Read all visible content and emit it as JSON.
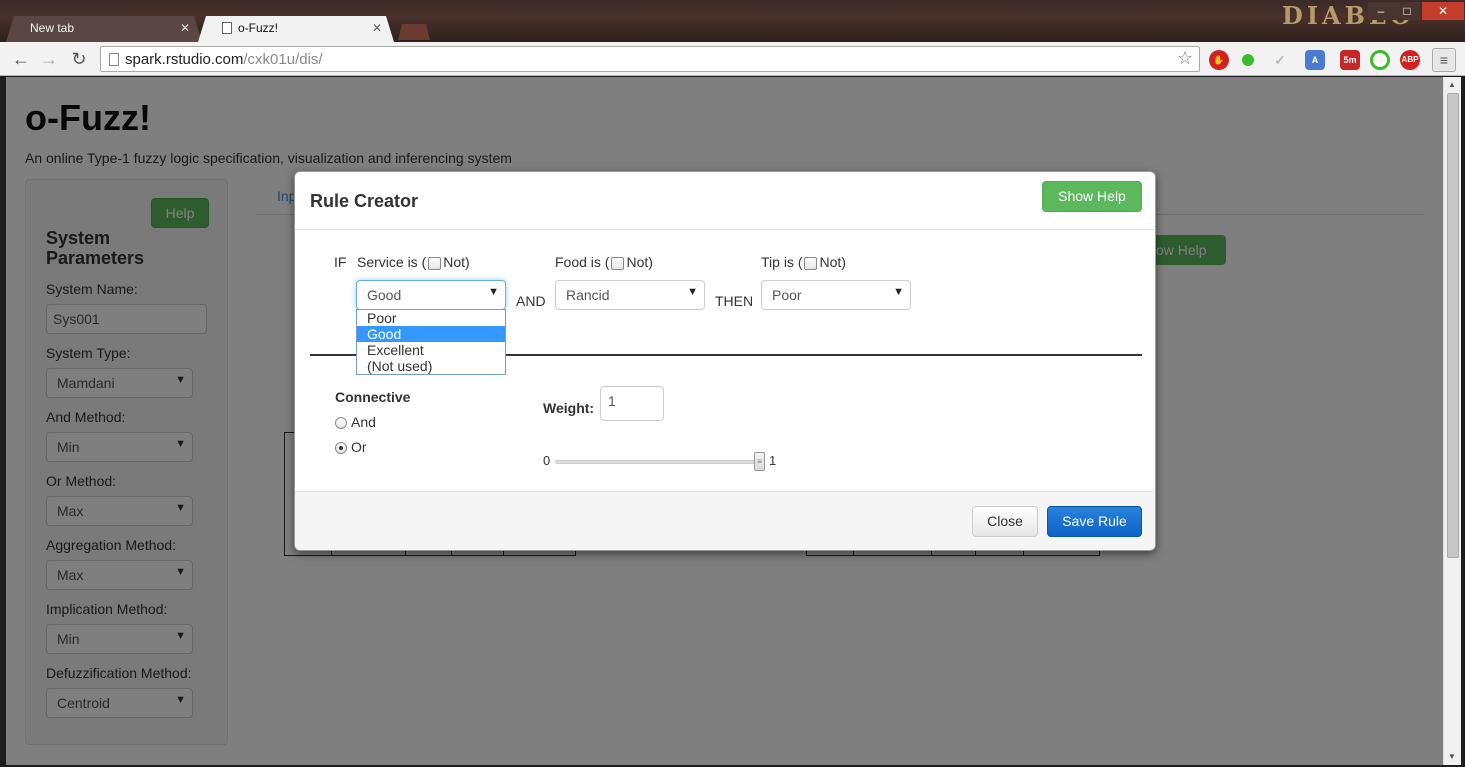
{
  "browser": {
    "tabs": [
      {
        "label": "New tab",
        "active": false
      },
      {
        "label": "o-Fuzz!",
        "active": true
      }
    ],
    "url_host": "spark.rstudio.com",
    "url_path": "/cxk01u/dis/",
    "logo_text": "DIABLO",
    "ext_labels": {
      "timer": "5m",
      "abp": "ABP"
    },
    "icons": [
      "back-icon",
      "forward-icon",
      "reload-icon",
      "star-icon",
      "menu-icon"
    ]
  },
  "app": {
    "title": "o-Fuzz!",
    "subtitle": "An online Type-1 fuzzy logic specification, visualization and inferencing system"
  },
  "sidebar": {
    "help_label": "Help",
    "title": "System Parameters",
    "system_name_label": "System Name:",
    "system_name_value": "Sys001",
    "system_type_label": "System Type:",
    "system_type_value": "Mamdani",
    "and_method_label": "And Method:",
    "and_method_value": "Min",
    "or_method_label": "Or Method:",
    "or_method_value": "Max",
    "aggregation_label": "Aggregation Method:",
    "aggregation_value": "Max",
    "implication_label": "Implication Method:",
    "implication_value": "Min",
    "defuzz_label": "Defuzzification Method:",
    "defuzz_value": "Centroid"
  },
  "background": {
    "tab_link": "Inp",
    "show_help_fragment": "ow Help"
  },
  "modal": {
    "title": "Rule Creator",
    "show_help_label": "Show Help",
    "if_label": "IF",
    "and_label": "AND",
    "then_label": "THEN",
    "not_label": "Not)",
    "service": {
      "label": "Service is (",
      "value": "Good",
      "options": [
        "Poor",
        "Good",
        "Excellent",
        "(Not used)"
      ],
      "selected_index": 1
    },
    "food": {
      "label": "Food is (",
      "value": "Rancid"
    },
    "tip": {
      "label": "Tip is (",
      "value": "Poor"
    },
    "connective": {
      "title": "Connective",
      "options": [
        "And",
        "Or"
      ],
      "selected": "Or"
    },
    "weight": {
      "label": "Weight:",
      "value": "1",
      "slider_min": "0",
      "slider_max": "1",
      "slider_value": 1
    },
    "close_label": "Close",
    "save_label": "Save Rule"
  },
  "colors": {
    "primary": "#0c63c8",
    "success": "#5cb85c",
    "dropdown_highlight": "#3399ff"
  }
}
